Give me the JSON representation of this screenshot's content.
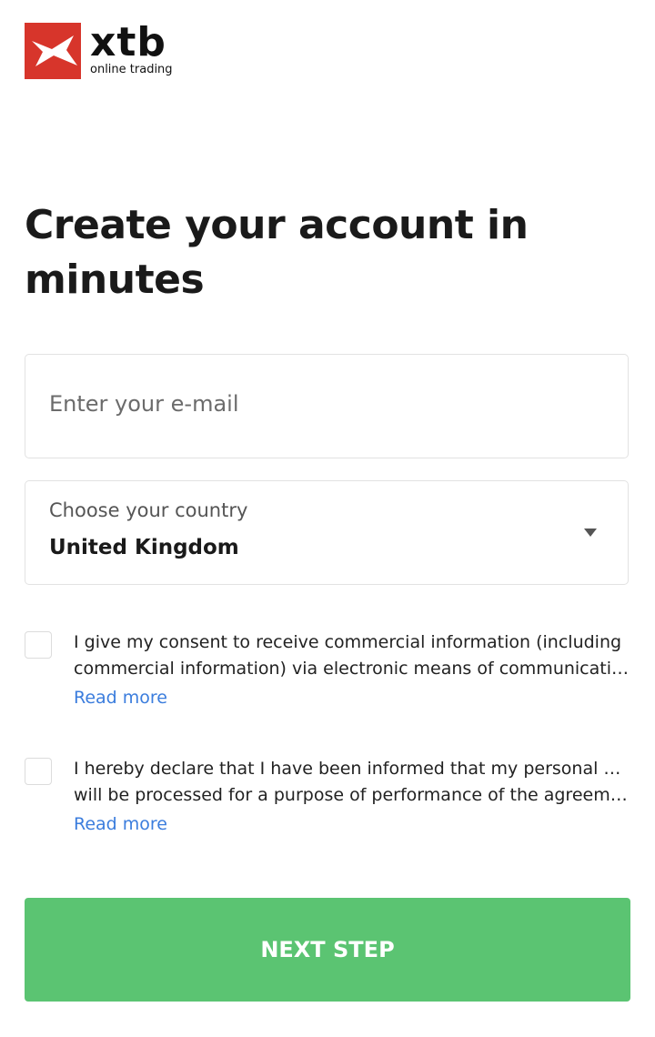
{
  "brand": {
    "wordmark": "xtb",
    "tagline": "online trading",
    "mark_color": "#d7352b"
  },
  "page": {
    "title": "Create your account in minutes"
  },
  "form": {
    "email": {
      "placeholder": "Enter your e-mail",
      "value": ""
    },
    "country": {
      "label": "Choose your country",
      "value": "United Kingdom"
    },
    "consents": [
      {
        "checked": false,
        "line1": "I give my consent to receive commercial information (including",
        "line2": "commercial information) via electronic means of communication...",
        "read_more": "Read more"
      },
      {
        "checked": false,
        "line1": "I hereby declare that I have been informed that my personal data",
        "line2": "will be processed for a purpose of performance of the agreement...",
        "read_more": "Read more"
      }
    ],
    "submit_label": "NEXT STEP",
    "submit_color": "#5bc472",
    "link_color": "#3b7ddd"
  }
}
